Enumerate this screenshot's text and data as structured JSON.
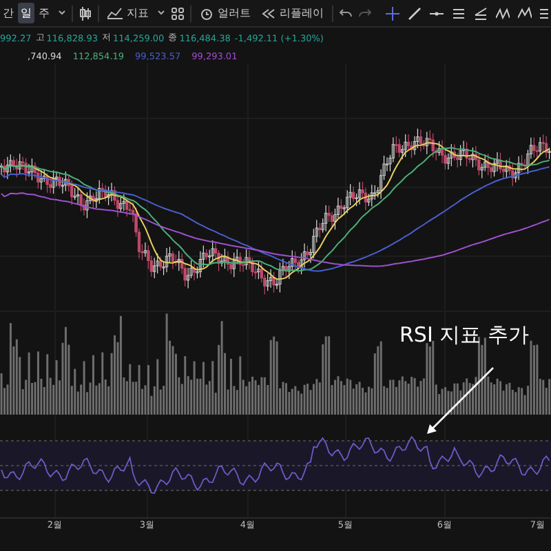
{
  "toolbar": {
    "intervals": [
      {
        "label": "간",
        "selected": false
      },
      {
        "label": "일",
        "selected": true
      },
      {
        "label": "주",
        "selected": false
      }
    ],
    "indicators_button": {
      "label": "지표"
    },
    "alert_button": {
      "label": "얼러트"
    },
    "replay_button": {
      "label": "리플레이"
    }
  },
  "ohlc": {
    "open_partial": "992.27",
    "values": [
      {
        "label": "고",
        "value": "116,828.93"
      },
      {
        "label": "저",
        "value": "114,259.00"
      },
      {
        "label": "종",
        "value": "116,484.38"
      }
    ],
    "change": "-1,492.11 (+1.30%)"
  },
  "moving_averages": [
    {
      "value": ",740.94",
      "color": "#d8d8d8"
    },
    {
      "value": "112,854.19",
      "color": "#4caf7a"
    },
    {
      "value": "99,523.57",
      "color": "#4a5fd0"
    },
    {
      "value": "99,293.01",
      "color": "#a050d0"
    }
  ],
  "x_axis": [
    "2월",
    "3월",
    "4월",
    "5월",
    "6월",
    "7월"
  ],
  "annotation": {
    "text": "RSI 지표 추가"
  }
}
